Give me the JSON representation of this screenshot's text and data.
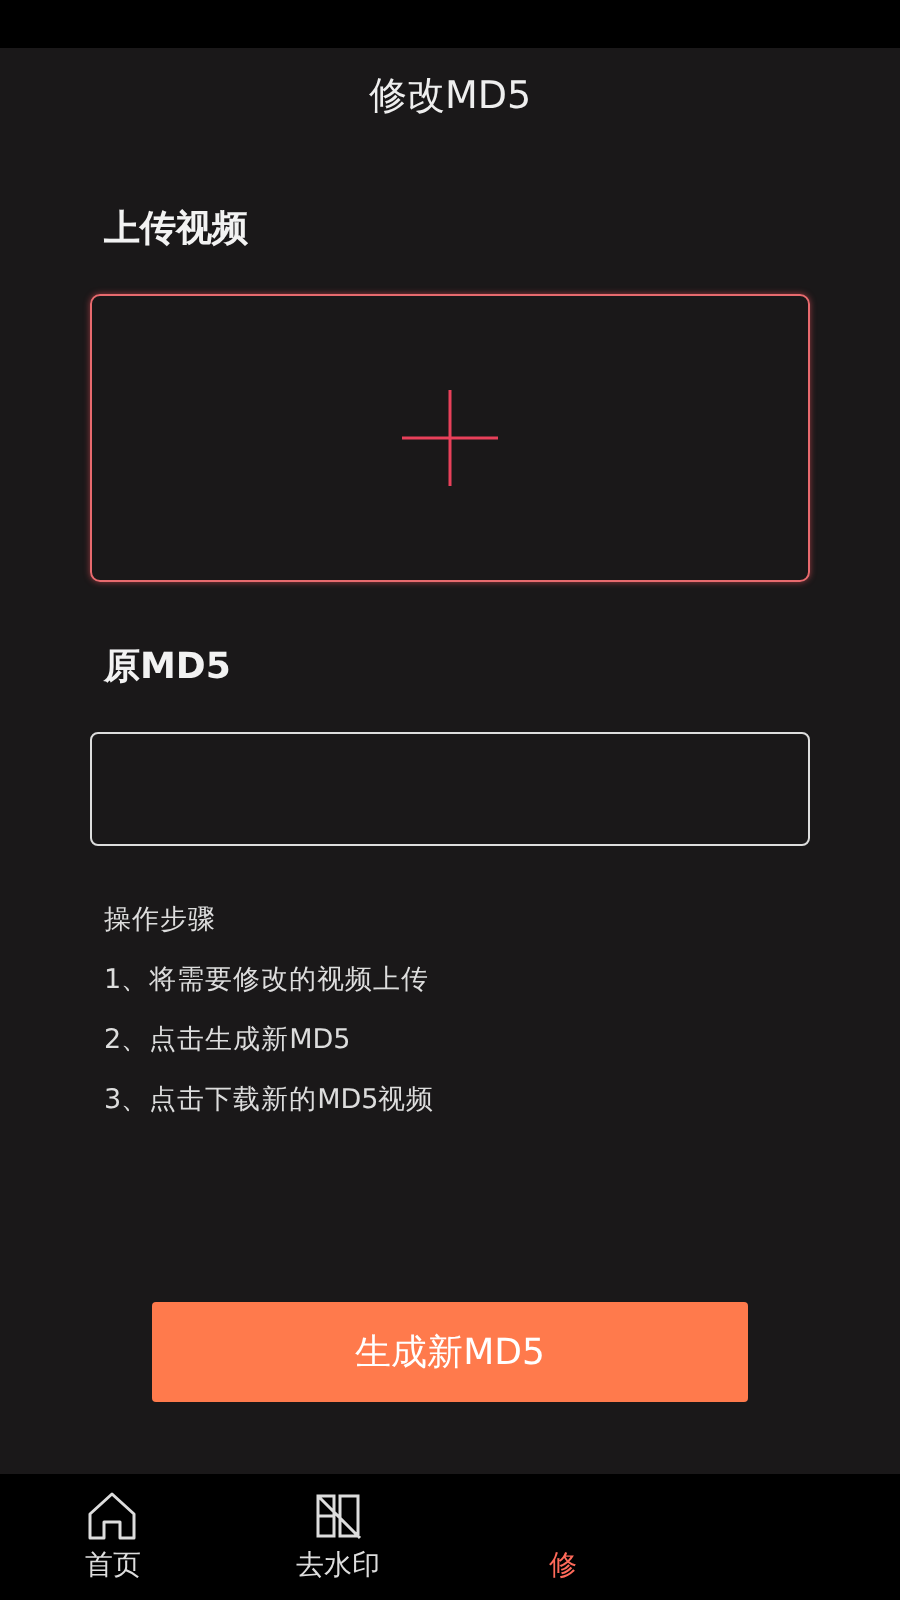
{
  "header": {
    "title": "修改MD5"
  },
  "upload": {
    "label": "上传视频"
  },
  "original_md5": {
    "label": "原MD5"
  },
  "steps": {
    "title": "操作步骤",
    "items": [
      "1、将需要修改的视频上传",
      "2、点击生成新MD5",
      "3、点击下载新的MD5视频"
    ]
  },
  "primary_button": {
    "label": "生成新MD5"
  },
  "tabs": [
    {
      "label": "首页",
      "kind": "home",
      "selected": false
    },
    {
      "label": "去水印",
      "kind": "unmark",
      "selected": false
    },
    {
      "label": "修",
      "kind": "none",
      "selected": true
    }
  ]
}
